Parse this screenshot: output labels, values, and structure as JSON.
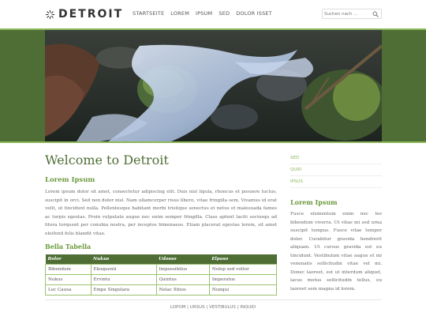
{
  "header": {
    "logo_text": "DETROIT",
    "nav": [
      "STARTSEITE",
      "LOREM",
      "IPSUM",
      "SED",
      "DOLOR ISSET"
    ],
    "search_placeholder": "Suchen nach ..."
  },
  "colors": {
    "accent_dark": "#4f6e35",
    "accent_light": "#8cb85a",
    "heading_green": "#6b9a3c"
  },
  "main": {
    "title": "Welcome to Detroit",
    "section_heading": "Lorem Ipsum",
    "paragraph1": "Lorem ipsum dolor sit amet, consectetur adipiscing elit. Duis nisl ligula, rhoncus et posuere luctus, suscipit in orci. Sed non dolor nisl. Nam ullamcorper risus libero, vitae fringilla sem. Vivamus id erat velit, ut tincidunt nulla. Pellentesque habitant morbi tristique senectus et netus et malesuada fames ac turpis egestas. Proin vulputate augue nec enim semper fringilla. Class aptent taciti sociosqu ad litora torquent per conubia nostra, per inceptos himenaeos. Etiam placerat egestas lorem, sit amet eleifend felis blandit vitae.",
    "table_title": "Bella Tabella",
    "table": {
      "headers": [
        "Bolor",
        "Nukus",
        "Udosso",
        "Elpaso"
      ],
      "rows": [
        [
          "Bibendum",
          "Ekoquenti",
          "Impossibilus",
          "Nolep sed voltor"
        ],
        [
          "Nukus",
          "Ervintu",
          "Quintus",
          "Imperatus"
        ],
        [
          "Loc Causa",
          "Empe Singulara",
          "Nelac Ithios",
          "Nunqui"
        ]
      ]
    }
  },
  "sidebar": {
    "links": [
      "SED",
      "QUID",
      "IPSUS"
    ],
    "title": "Lorem Ipsum",
    "text": "Fusce elementum enim nec leo bibendum viverra. Ut vitae mi sed urna suscipit tempus. Fusce vitae tempor dolor. Curabitur gravida hendrerit aliquam. Ut cursus gravida est eu tincidunt. Vestibulum vitae augue et mi venenatis sollicitudin vitae vel mi. Donec laoreet, est ut interdum aliquet, lacus metus sollicitudin tellus, eu laoreet sem magna id lorem."
  },
  "footer": {
    "links": [
      "LOPOM",
      "URSUS",
      "VESTIBULUS",
      "INQUID"
    ]
  }
}
